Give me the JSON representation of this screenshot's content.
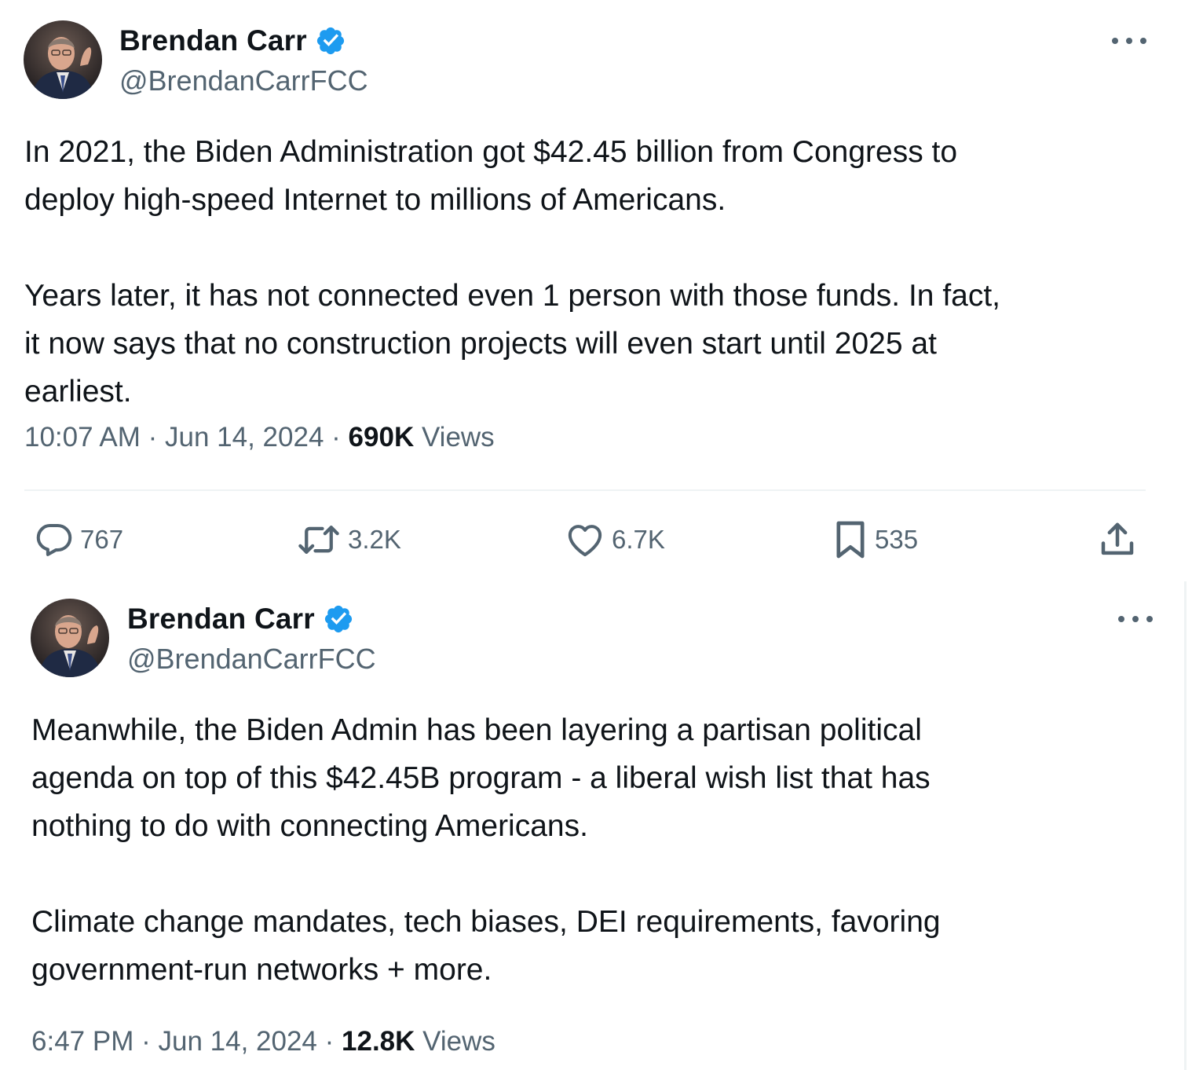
{
  "tweets": [
    {
      "author": {
        "display_name": "Brendan Carr",
        "handle": "@BrendanCarrFCC",
        "verified": true
      },
      "text": "In 2021, the Biden Administration got $42.45 billion from Congress to\ndeploy high-speed Internet to millions of Americans.\n\nYears later, it has not connected even 1 person with those funds. In fact,\nit now says that no construction projects will even start until 2025 at\nearliest.",
      "time": "10:07 AM",
      "separator": "·",
      "date": "Jun 14, 2024",
      "views": "690K",
      "views_label": "Views",
      "actions": {
        "replies": "767",
        "reposts": "3.2K",
        "likes": "6.7K",
        "bookmarks": "535"
      }
    },
    {
      "author": {
        "display_name": "Brendan Carr",
        "handle": "@BrendanCarrFCC",
        "verified": true
      },
      "text": "Meanwhile, the Biden Admin has been layering a partisan political\nagenda on top of this $42.45B program - a liberal wish list that has\nnothing to do with connecting Americans.\n\nClimate change mandates, tech biases, DEI requirements, favoring\ngovernment-run networks + more.",
      "time": "6:47 PM",
      "separator": "·",
      "date": "Jun 14, 2024",
      "views": "12.8K",
      "views_label": "Views"
    }
  ],
  "colors": {
    "text_primary": "#0f1419",
    "text_secondary": "#536471",
    "verified_blue": "#1d9bf0",
    "divider": "#eff3f4"
  },
  "icons": {
    "verified": "verified-badge-icon",
    "more": "more-dots-icon",
    "reply": "reply-bubble-icon",
    "repost": "repost-arrows-icon",
    "like": "heart-icon",
    "bookmark": "bookmark-icon",
    "share": "share-upload-icon"
  }
}
